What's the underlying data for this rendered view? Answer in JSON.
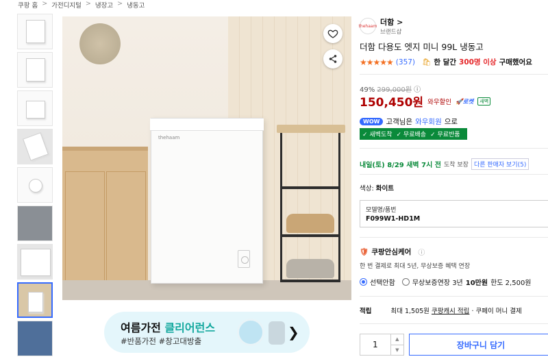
{
  "breadcrumb": [
    "쿠팡 홈",
    "가전디지털",
    "냉장고",
    "냉동고"
  ],
  "breadcrumb_sep": ">",
  "seller": {
    "logo_text": "thehaam",
    "name": "더함 >",
    "sub": "브랜드샵"
  },
  "product": {
    "title": "더함 다용도 엣지 미니 99L 냉동고"
  },
  "rating": {
    "stars": "★★★★★",
    "count": "(357)",
    "buyers_prefix": "한 달간",
    "buyers_count": "300명 이상",
    "buyers_suffix": "구매했어요"
  },
  "pricing": {
    "discount_rate": "49%",
    "original_price": "299,000원",
    "info_icon": "ⓘ",
    "sale_price": "150,450원",
    "wow_discount": "와우할인",
    "rocket_label": "로켓",
    "dawn_label": "새벽"
  },
  "wow": {
    "badge": "WOW",
    "text1": "고객님은",
    "text2": "와우회원",
    "text3": "으로"
  },
  "benefits": [
    "✓ 새벽도착",
    "✓ 무료배송",
    "✓ 무료반품"
  ],
  "delivery": {
    "text": "내일(토) 8/29 새벽 7시 전",
    "note": "도착 보장",
    "other_sellers": "다른 판매자 보기(5)"
  },
  "color": {
    "label": "색상:",
    "value": "화이트"
  },
  "model": {
    "label": "모델명/품번",
    "value": "F099W1-HD1M"
  },
  "care": {
    "title": "쿠팡안심케어",
    "info_icon": "ⓘ",
    "desc": "한 번 결제로 최대 5년, 무상보증 혜택 연장",
    "options": [
      {
        "label": "선택안함",
        "selected": true
      },
      {
        "label": "무상보증연장 3년",
        "bold": "10만원",
        "suffix": "한도 2,500원",
        "selected": false
      }
    ]
  },
  "cash": {
    "label": "적립",
    "text": "최대 1,505원",
    "link": "쿠팡캐시 적립",
    "rest": "· 쿠페이 머니 결제"
  },
  "quantity": {
    "value": "1"
  },
  "cart_button": "장바구니 담기",
  "banner": {
    "line1_a": "여름가전 ",
    "line1_b": "클리어런스",
    "line2": "#반품가전 #창고대방출",
    "arrow": "❯"
  },
  "image_brand": "thehaam",
  "colors": {
    "accent": "#346aff",
    "price": "#ae0000",
    "rocket_green": "#0a8a3a",
    "star": "#f36f21"
  }
}
